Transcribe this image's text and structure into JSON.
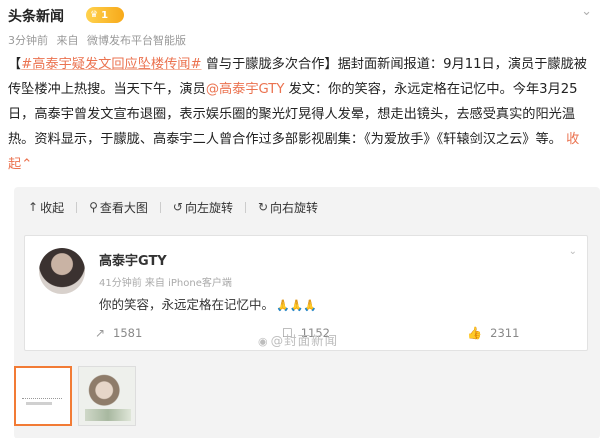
{
  "post": {
    "author": "头条新闻",
    "vip_level": "1",
    "time": "3分钟前",
    "source_prefix": "来自",
    "source": "微博发布平台智能版",
    "bracket_open": "【",
    "hashtag": "#高泰宇疑发文回应坠楼传闻#",
    "headline_rest": " 曾与于朦胧多次合作】据封面新闻报道：9月11日，演员于朦胧被传坠楼冲上热搜。当天下午，演员",
    "mention": "@高泰宇GTY",
    "body_rest": " 发文：你的笑容，永远定格在记忆中。今年3月25日，高泰宇曾发文宣布退圈，表示娱乐圈的聚光灯晃得人发晕，想走出镜头，去感受真实的阳光温热。资料显示，于朦胧、高泰宇二人曾合作过多部影视剧集：《为爱放手》《轩辕剑汉之云》等。 ",
    "collapse_label": "收起"
  },
  "viewer": {
    "toolbar": {
      "collapse": "收起",
      "view_large": "查看大图",
      "rotate_left": "向左旋转",
      "rotate_right": "向右旋转"
    },
    "card": {
      "name": "高泰宇GTY",
      "time": "41分钟前",
      "source": "来自 iPhone客户端",
      "text": "你的笑容，永远定格在记忆中。",
      "emoji": "🙏🙏🙏",
      "reposts": "1581",
      "comments": "1152",
      "likes": "2311"
    },
    "watermark": "@封面新闻"
  },
  "colors": {
    "link": "#eb7350",
    "vip_badge": "#f7a91a",
    "selected_thumb_border": "#f27b35"
  }
}
